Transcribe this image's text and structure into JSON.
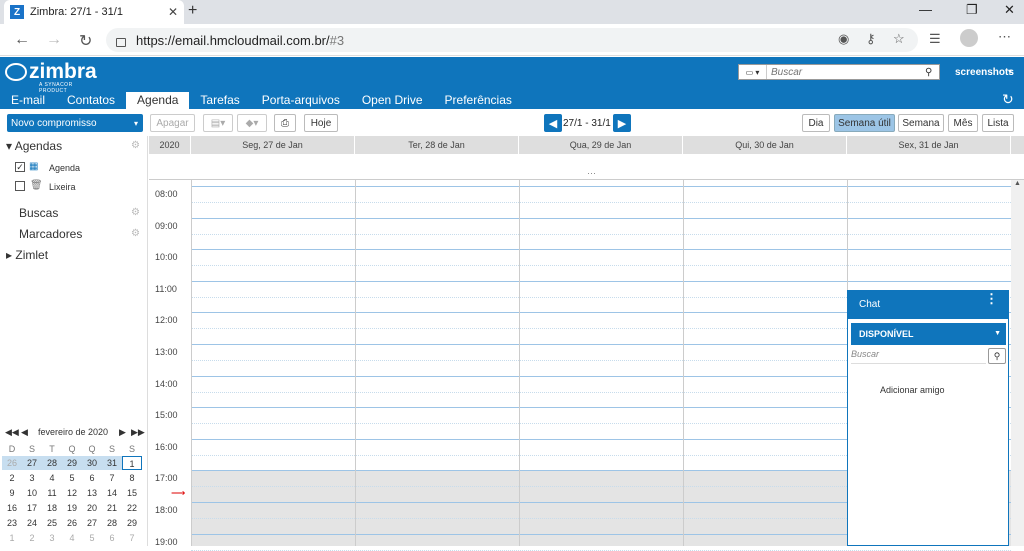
{
  "browser": {
    "tab_title": "Zimbra: 27/1 - 31/1",
    "tab_favicon": "Z",
    "url_main": "https://email.hmcloudmail.com.br/",
    "url_hash": "#3"
  },
  "header": {
    "logo_text": "zimbra",
    "logo_sub": "A SYNACOR PRODUCT",
    "search_placeholder": "Buscar",
    "username": "screenshots",
    "app_tabs": [
      "E-mail",
      "Contatos",
      "Agenda",
      "Tarefas",
      "Porta-arquivos",
      "Open Drive",
      "Preferências"
    ],
    "active_tab": "Agenda"
  },
  "toolbar": {
    "new_appointment": "Novo compromisso",
    "delete": "Apagar",
    "today": "Hoje",
    "date_range": "27/1 - 31/1",
    "views": [
      "Dia",
      "Semana útil",
      "Semana",
      "Mês",
      "Lista"
    ],
    "active_view": "Semana útil"
  },
  "sidebar": {
    "agendas_label": "Agendas",
    "agenda_item": "Agenda",
    "trash_item": "Lixeira",
    "searches_label": "Buscas",
    "tags_label": "Marcadores",
    "zimlet_label": "Zimlet"
  },
  "minical": {
    "month_label": "fevereiro de 2020",
    "weekdays": [
      "D",
      "S",
      "T",
      "Q",
      "Q",
      "S",
      "S"
    ],
    "weeks": [
      [
        "26",
        "27",
        "28",
        "29",
        "30",
        "31",
        "1"
      ],
      [
        "2",
        "3",
        "4",
        "5",
        "6",
        "7",
        "8"
      ],
      [
        "9",
        "10",
        "11",
        "12",
        "13",
        "14",
        "15"
      ],
      [
        "16",
        "17",
        "18",
        "19",
        "20",
        "21",
        "22"
      ],
      [
        "23",
        "24",
        "25",
        "26",
        "27",
        "28",
        "29"
      ],
      [
        "1",
        "2",
        "3",
        "4",
        "5",
        "6",
        "7"
      ]
    ]
  },
  "calendar": {
    "year": "2020",
    "days": [
      "Seg, 27 de Jan",
      "Ter, 28 de Jan",
      "Qua, 29 de Jan",
      "Qui, 30 de Jan",
      "Sex, 31 de Jan"
    ],
    "hours": [
      "08:00",
      "09:00",
      "10:00",
      "11:00",
      "12:00",
      "13:00",
      "14:00",
      "15:00",
      "16:00",
      "17:00",
      "18:00",
      "19:00"
    ]
  },
  "chat": {
    "title": "Chat",
    "status": "DISPONÍVEL",
    "search_placeholder": "Buscar",
    "add_friend": "Adicionar amigo"
  },
  "colors": {
    "brand": "#0f75bc",
    "active_view": "#9cc5e6"
  }
}
